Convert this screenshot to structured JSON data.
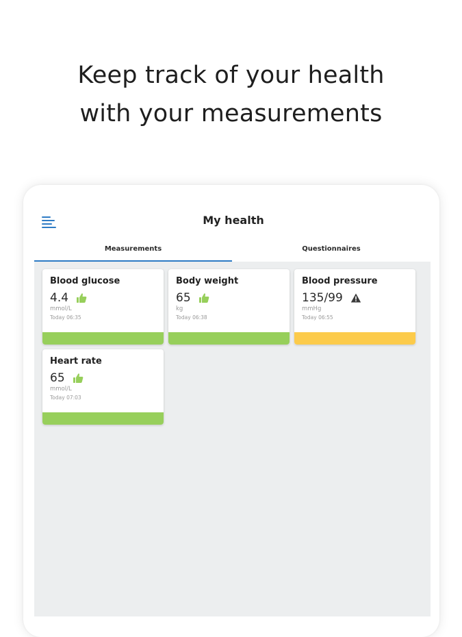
{
  "headline": {
    "line1": "Keep track of your health",
    "line2": "with your measurements"
  },
  "app": {
    "title": "My health",
    "menu_icon": "menu-icon"
  },
  "tabs": [
    {
      "label": "Measurements",
      "active": true
    },
    {
      "label": "Questionnaires",
      "active": false
    }
  ],
  "colors": {
    "accent": "#2d7bc5",
    "status_good": "#97cf5b",
    "status_warning": "#fccb4b",
    "content_background": "#eceeef"
  },
  "measurements": [
    {
      "title": "Blood glucose",
      "value": "4.4",
      "unit": "mmol/L",
      "time": "Today 06:35",
      "status": "good",
      "icon": "thumbs-up-icon"
    },
    {
      "title": "Body weight",
      "value": "65",
      "unit": "kg",
      "time": "Today 06:38",
      "status": "good",
      "icon": "thumbs-up-icon"
    },
    {
      "title": "Blood pressure",
      "value": "135/99",
      "unit": "mmHg",
      "time": "Today 06:55",
      "status": "warning",
      "icon": "warning-triangle-icon"
    },
    {
      "title": "Heart rate",
      "value": "65",
      "unit": "mmol/L",
      "time": "Today 07:03",
      "status": "good",
      "icon": "thumbs-up-icon"
    }
  ]
}
